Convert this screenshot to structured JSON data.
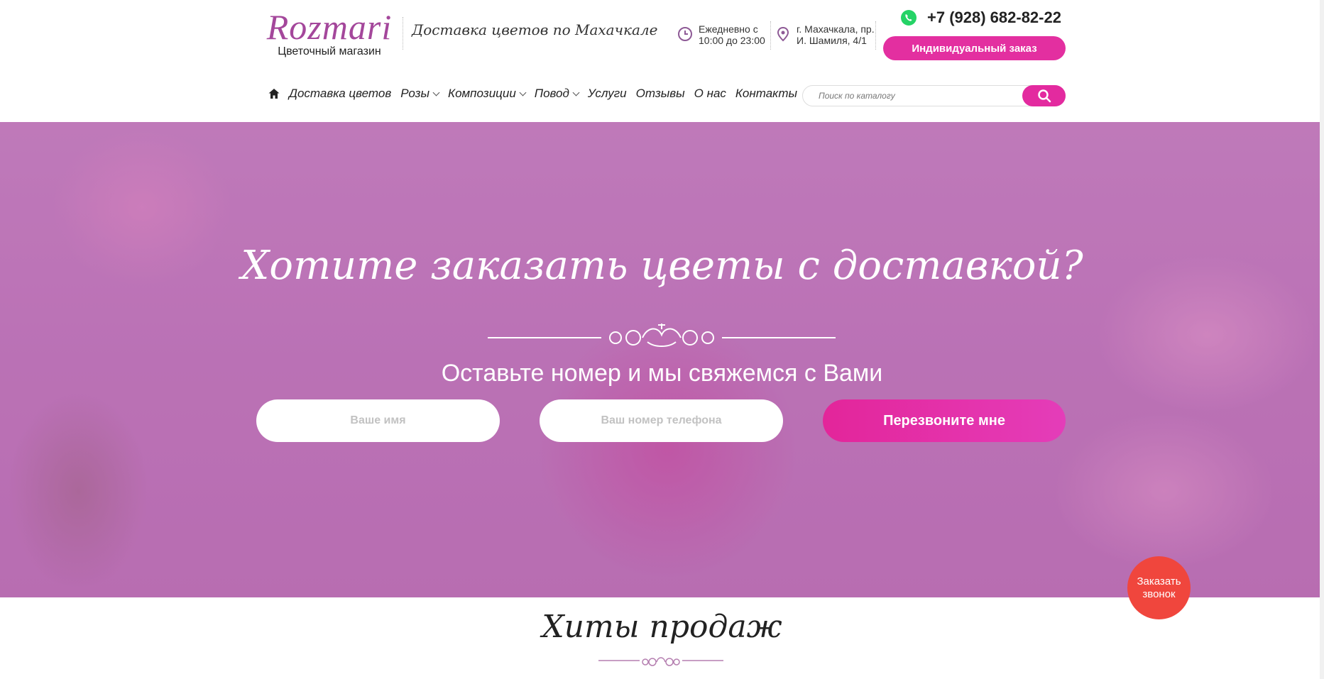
{
  "header": {
    "logo_title": "Rozmari",
    "logo_subtitle": "Цветочный магазин",
    "tagline": "Доставка цветов по Махачкале",
    "hours_line1": "Ежедневно с",
    "hours_line2": "10:00 до 23:00",
    "address_line1": "г. Махачкала, пр.",
    "address_line2": "И. Шамиля, 4/1",
    "phone": "+7 (928) 682-82-22",
    "order_button": "Индивидуальный заказ"
  },
  "nav": {
    "items": [
      {
        "label": "Доставка цветов",
        "dropdown": false
      },
      {
        "label": "Розы",
        "dropdown": true
      },
      {
        "label": "Композиции",
        "dropdown": true
      },
      {
        "label": "Повод",
        "dropdown": true
      },
      {
        "label": "Услуги",
        "dropdown": false
      },
      {
        "label": "Отзывы",
        "dropdown": false
      },
      {
        "label": "О нас",
        "dropdown": false
      },
      {
        "label": "Контакты",
        "dropdown": false
      }
    ]
  },
  "search": {
    "placeholder": "Поиск по каталогу"
  },
  "hero": {
    "title": "Хотите заказать цветы с доставкой?",
    "subtitle": "Оставьте номер и мы свяжемся с Вами",
    "name_placeholder": "Ваше имя",
    "phone_placeholder": "Ваш номер телефона",
    "submit": "Перезвоните мне"
  },
  "hits": {
    "title": "Хиты продаж"
  },
  "callback": {
    "line1": "Заказать",
    "line2": "звонок"
  },
  "colors": {
    "brand": "#a4479b",
    "accent": "#e32fa0",
    "callback": "#f0463d",
    "whatsapp": "#25d366"
  },
  "icons": [
    "clock-icon",
    "location-pin-icon",
    "whatsapp-icon",
    "home-icon",
    "search-icon"
  ]
}
